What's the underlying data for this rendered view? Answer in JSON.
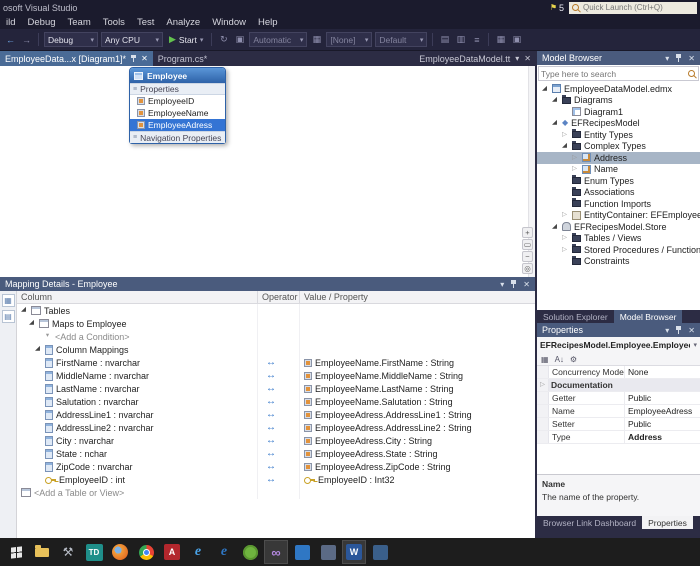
{
  "colors": {
    "titlebar_bg": "#1b1b2d",
    "toolbar_bg": "#24243b",
    "chrome_bg": "#2c2c44",
    "panel_header": "#4a5b7d",
    "doc_tab_active": "#4a6b96",
    "selection_blue": "#3474d4",
    "selection_inactive": "#a7b5c6",
    "taskbar_bg": "#1d1d1d"
  },
  "icons": {
    "expander_open": "◢",
    "expander_closed": "▷",
    "chevron_down": "▾",
    "close": "✕",
    "operator": "↔",
    "back_arrow": "←",
    "forward_arrow": "→",
    "play": "▶",
    "flag": "⚑",
    "section_grip": "≡",
    "grid": "▦",
    "rows": "▤",
    "columns": "▥",
    "list": "≡",
    "refresh": "↻",
    "blocks": "▣",
    "zoom_in": "+",
    "zoom_fit": "▭",
    "zoom_out": "−",
    "pan": "◎",
    "sort_az": "A↓",
    "gear": "⚙",
    "infinity": "∞"
  },
  "titlebar": {
    "title": "osoft Visual Studio",
    "notification_count": "5",
    "quick_launch_placeholder": "Quick Launch (Ctrl+Q)"
  },
  "menubar": {
    "items": [
      {
        "label": "ild"
      },
      {
        "label": "Debug"
      },
      {
        "label": "Team"
      },
      {
        "label": "Tools"
      },
      {
        "label": "Test"
      },
      {
        "label": "Analyze"
      },
      {
        "label": "Window"
      },
      {
        "label": "Help"
      }
    ]
  },
  "toolbar": {
    "debug_target": "Debug",
    "platform": "Any CPU",
    "start_label": "Start",
    "device_combo": "Automatic",
    "debug_location": "[None]",
    "process_combo": "Default"
  },
  "editor": {
    "tab1": "EmployeeData...x [Diagram1]*",
    "tab2": "Program.cs*",
    "right_file_label": "EmployeeDataModel.tt",
    "entity": {
      "title": "Employee",
      "properties_header": "Properties",
      "items": [
        "EmployeeID",
        "EmployeeName",
        "EmployeeAdress"
      ],
      "nav_header": "Navigation Properties"
    }
  },
  "mapping": {
    "title": "Mapping Details - Employee",
    "col_column": "Column",
    "col_operator": "Operator",
    "col_value": "Value / Property",
    "tables_label": "Tables",
    "maps_label": "Maps to Employee",
    "add_condition": "<Add a Condition>",
    "column_mappings": "Column Mappings",
    "add_table": "<Add a Table or View>",
    "rows": [
      {
        "column": "FirstName : nvarchar",
        "value": "EmployeeName.FirstName : String"
      },
      {
        "column": "MiddleName : nvarchar",
        "value": "EmployeeName.MiddleName : String"
      },
      {
        "column": "LastName : nvarchar",
        "value": "EmployeeName.LastName : String"
      },
      {
        "column": "Salutation : nvarchar",
        "value": "EmployeeName.Salutation : String"
      },
      {
        "column": "AddressLine1 : nvarchar",
        "value": "EmployeeAdress.AddressLine1 : String"
      },
      {
        "column": "AddressLine2 : nvarchar",
        "value": "EmployeeAdress.AddressLine2 : String"
      },
      {
        "column": "City : nvarchar",
        "value": "EmployeeAdress.City : String"
      },
      {
        "column": "State : nchar",
        "value": "EmployeeAdress.State : String"
      },
      {
        "column": "ZipCode : nvarchar",
        "value": "EmployeeAdress.ZipCode : String"
      },
      {
        "column": "EmployeeID : int",
        "value": "EmployeeID : Int32"
      }
    ]
  },
  "model_browser": {
    "title": "Model Browser",
    "search_placeholder": "Type here to search",
    "nodes": [
      {
        "label": "EmployeeDataModel.edmx"
      },
      {
        "label": "Diagrams"
      },
      {
        "label": "Diagram1"
      },
      {
        "label": "EFRecipesModel"
      },
      {
        "label": "Entity Types"
      },
      {
        "label": "Complex Types"
      },
      {
        "label": "Address"
      },
      {
        "label": "Name"
      },
      {
        "label": "Enum Types"
      },
      {
        "label": "Associations"
      },
      {
        "label": "Function Imports"
      },
      {
        "label": "EntityContainer: EFEmployeeEnt"
      },
      {
        "label": "EFRecipesModel.Store"
      },
      {
        "label": "Tables / Views"
      },
      {
        "label": "Stored Procedures / Functions"
      },
      {
        "label": "Constraints"
      }
    ]
  },
  "panel_tabs": {
    "solution_explorer": "Solution Explorer",
    "model_browser": "Model Browser",
    "browser_link": "Browser Link Dashboard",
    "properties": "Properties"
  },
  "properties_panel": {
    "title": "Properties",
    "object_name": "EFRecipesModel.Employee.EmployeeAdress",
    "rows": [
      {
        "name": "Concurrency Mode",
        "value": "None"
      },
      {
        "name": "Documentation",
        "value": ""
      },
      {
        "name": "Getter",
        "value": "Public"
      },
      {
        "name": "Name",
        "value": "EmployeeAdress"
      },
      {
        "name": "Setter",
        "value": "Public"
      },
      {
        "name": "Type",
        "value": "Address"
      }
    ],
    "description_title": "Name",
    "description_text": "The name of the property."
  },
  "taskbar": {
    "icons": [
      {
        "name": "start"
      },
      {
        "name": "file-explorer"
      },
      {
        "name": "toolbox",
        "glyph": "⚒"
      },
      {
        "name": "td-app",
        "glyph": "TD"
      },
      {
        "name": "firefox"
      },
      {
        "name": "chrome"
      },
      {
        "name": "acrobat-reader",
        "glyph": "A"
      },
      {
        "name": "internet-explorer",
        "glyph": "e"
      },
      {
        "name": "edge",
        "glyph": "e"
      },
      {
        "name": "green-app"
      },
      {
        "name": "visual-studio",
        "glyph": "∞"
      },
      {
        "name": "blue-app"
      },
      {
        "name": "office-app"
      },
      {
        "name": "word",
        "glyph": "W"
      },
      {
        "name": "media-app"
      }
    ]
  }
}
